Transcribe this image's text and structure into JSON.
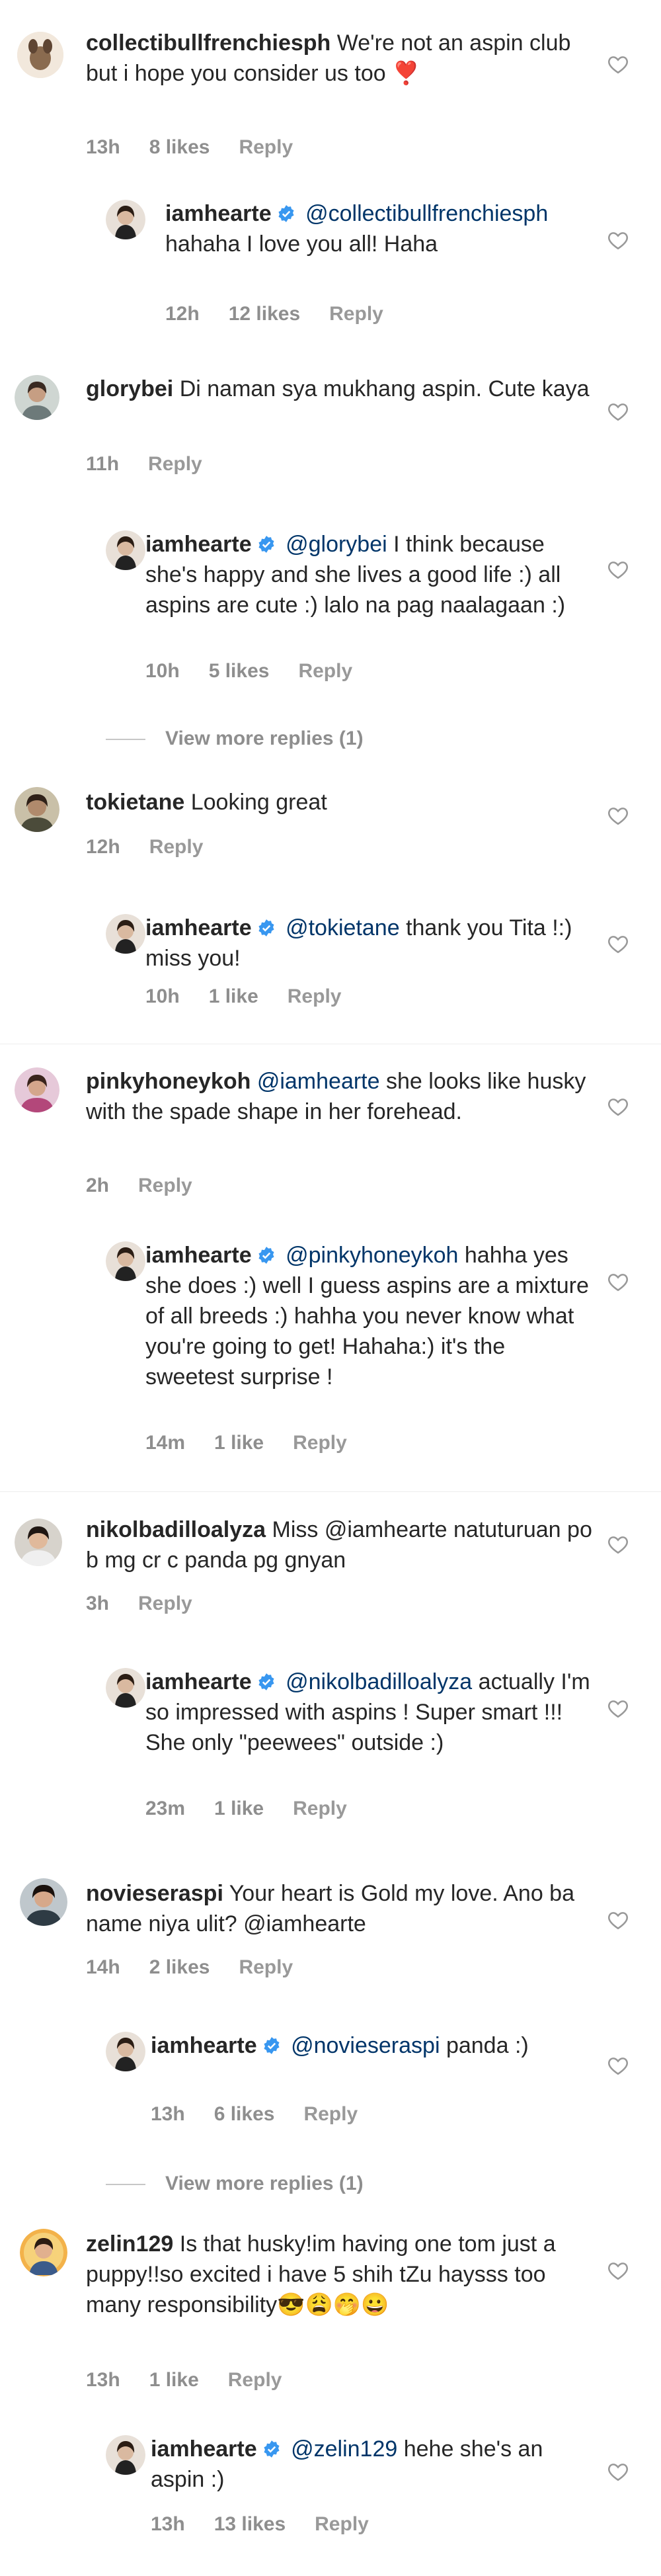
{
  "comments": [
    {
      "user": "collectibullfrenchiesph",
      "verified": false,
      "mention": "",
      "text": "We're not an aspin club but i hope you consider us too ❣️",
      "time": "13h",
      "likes": "8 likes",
      "reply": "Reply"
    },
    {
      "user": "iamhearte",
      "verified": true,
      "mention": "@collectibullfrenchiesph",
      "text": "hahaha I love you all! Haha",
      "time": "12h",
      "likes": "12 likes",
      "reply": "Reply"
    },
    {
      "user": "glorybei",
      "verified": false,
      "mention": "",
      "text": "Di naman sya mukhang aspin. Cute kaya",
      "time": "11h",
      "likes": "",
      "reply": "Reply"
    },
    {
      "user": "iamhearte",
      "verified": true,
      "mention": "@glorybei",
      "text": "I think because she's happy and she lives a good life :) all aspins are cute :) lalo na pag naalagaan :)",
      "time": "10h",
      "likes": "5 likes",
      "reply": "Reply"
    },
    {
      "user": "tokietane",
      "verified": false,
      "mention": "",
      "text": "Looking great",
      "time": "12h",
      "likes": "",
      "reply": "Reply"
    },
    {
      "user": "iamhearte",
      "verified": true,
      "mention": "@tokietane",
      "text": "thank you Tita !:) miss you!",
      "time": "10h",
      "likes": "1 like",
      "reply": "Reply"
    },
    {
      "user": "pinkyhoneykoh",
      "verified": false,
      "mention": "@iamhearte",
      "text": "she looks like husky with the spade shape in her forehead.",
      "time": "2h",
      "likes": "",
      "reply": "Reply"
    },
    {
      "user": "iamhearte",
      "verified": true,
      "mention": "@pinkyhoneykoh",
      "text": "hahha yes she does :) well I guess aspins are a mixture of all breeds :) hahha you never know what you're going to get! Hahaha:) it's the sweetest surprise !",
      "time": "14m",
      "likes": "1 like",
      "reply": "Reply"
    },
    {
      "user": "nikolbadilloalyza",
      "verified": false,
      "mention": "",
      "text": "Miss @iamhearte natuturuan po b mg cr c panda pg gnyan",
      "time": "3h",
      "likes": "",
      "reply": "Reply"
    },
    {
      "user": "iamhearte",
      "verified": true,
      "mention": "@nikolbadilloalyza",
      "text": "actually I'm so impressed with aspins ! Super smart !!! She only \"peewees\" outside :)",
      "time": "23m",
      "likes": "1 like",
      "reply": "Reply"
    },
    {
      "user": "novieseraspi",
      "verified": false,
      "mention": "",
      "text": "Your heart is Gold my love. Ano ba name niya ulit? @iamhearte",
      "time": "14h",
      "likes": "2 likes",
      "reply": "Reply"
    },
    {
      "user": "iamhearte",
      "verified": true,
      "mention": "@novieseraspi",
      "text": "panda :)",
      "time": "13h",
      "likes": "6 likes",
      "reply": "Reply"
    },
    {
      "user": "zelin129",
      "verified": false,
      "mention": "",
      "text": "Is that husky!im having one tom just a puppy!!so excited i have 5 shih tZu haysss too many responsibility😎😩🤭😀",
      "time": "13h",
      "likes": "1 like",
      "reply": "Reply"
    },
    {
      "user": "iamhearte",
      "verified": true,
      "mention": "@zelin129",
      "text": "hehe she's an aspin :)",
      "time": "13h",
      "likes": "13 likes",
      "reply": "Reply"
    }
  ],
  "view_more": [
    "View more replies (1)",
    "View more replies (1)"
  ]
}
